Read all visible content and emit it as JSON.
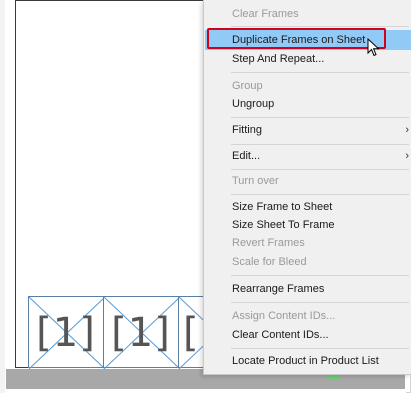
{
  "canvas": {
    "frames": [
      {
        "label": "[1]"
      },
      {
        "label": "[1]"
      },
      {
        "label": "["
      }
    ]
  },
  "context_menu": {
    "items": {
      "clear_frames": "Clear Frames",
      "duplicate_frames": "Duplicate Frames on Sheet",
      "step_and_repeat": "Step And Repeat...",
      "group": "Group",
      "ungroup": "Ungroup",
      "fitting": "Fitting",
      "edit": "Edit...",
      "turn_over": "Turn over",
      "size_frame_to_sheet": "Size Frame to Sheet",
      "size_sheet_to_frame": "Size Sheet To Frame",
      "revert_frames": "Revert Frames",
      "scale_for_bleed": "Scale for Bleed",
      "rearrange_frames": "Rearrange Frames",
      "assign_content_ids": "Assign Content IDs...",
      "clear_content_ids": "Clear Content IDs...",
      "locate_product": "Locate Product in Product List"
    },
    "submenu_arrow": "›",
    "highlighted_item": "Duplicate Frames on Sheet"
  },
  "colors": {
    "highlight": "#91c9f7",
    "callout_border": "#d0021b",
    "frame_border": "#5b7ea3"
  }
}
